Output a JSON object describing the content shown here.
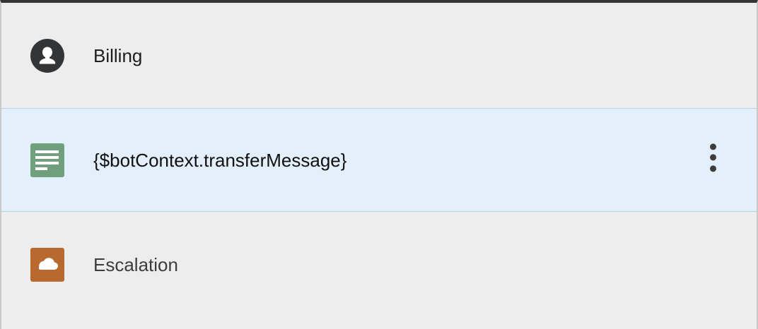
{
  "rows": [
    {
      "icon": "person-icon",
      "label": "Billing",
      "selected": false,
      "icon_color": "#333436"
    },
    {
      "icon": "message-document-icon",
      "label": "{$botContext.transferMessage}",
      "selected": true,
      "icon_color": "#6f9f7d",
      "actions_icon": "more-vertical-icon"
    },
    {
      "icon": "cloud-icon",
      "label": "Escalation",
      "selected": false,
      "icon_color": "#b8692e"
    }
  ],
  "colors": {
    "selected_background": "#e3effb",
    "selected_border": "#b7d5ef",
    "panel_background": "#ededed",
    "top_border": "#333436"
  }
}
